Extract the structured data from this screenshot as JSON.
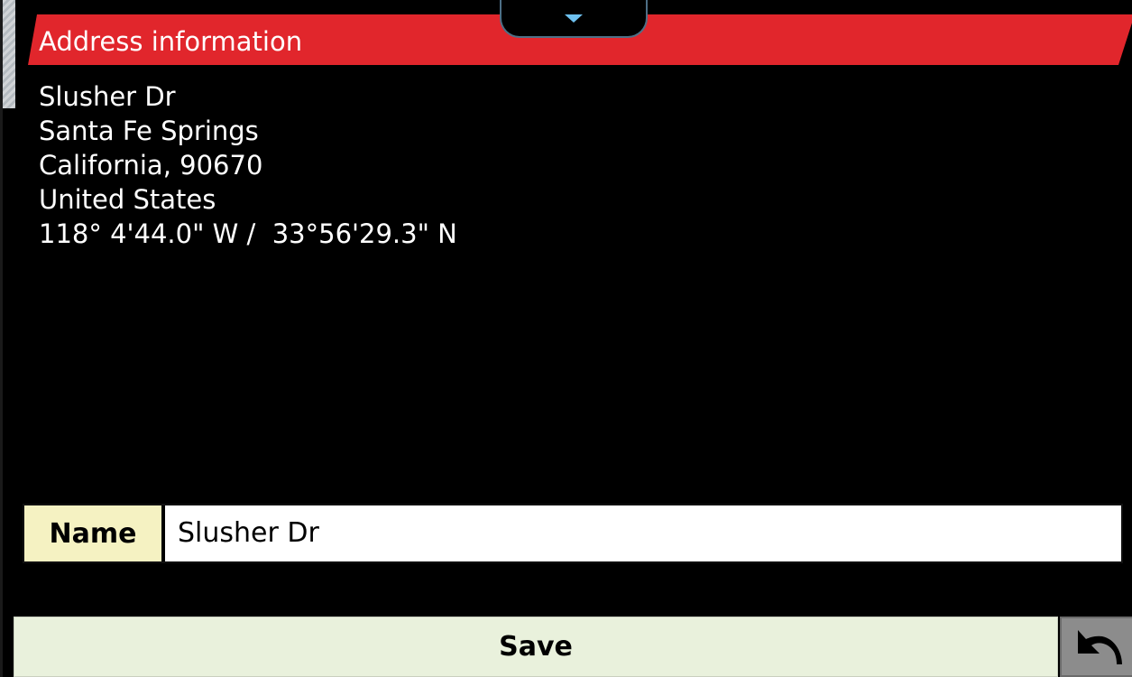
{
  "header": {
    "title": "Address information"
  },
  "address": {
    "street": "Slusher Dr",
    "city": "Santa Fe Springs",
    "state_zip": "California, 90670",
    "country": "United States",
    "coordinates": "118° 4'44.0\" W /  33°56'29.3\" N"
  },
  "name_field": {
    "label": "Name",
    "value": "Slusher Dr"
  },
  "actions": {
    "save_label": "Save",
    "back_icon": "undo-arrow-icon"
  },
  "colors": {
    "header_red": "#e1262c",
    "label_bg": "#f5f2c2",
    "save_bg": "#e9f1dc",
    "back_bg": "#8c8c8c",
    "pulldown_arrow": "#6ec1f0"
  }
}
